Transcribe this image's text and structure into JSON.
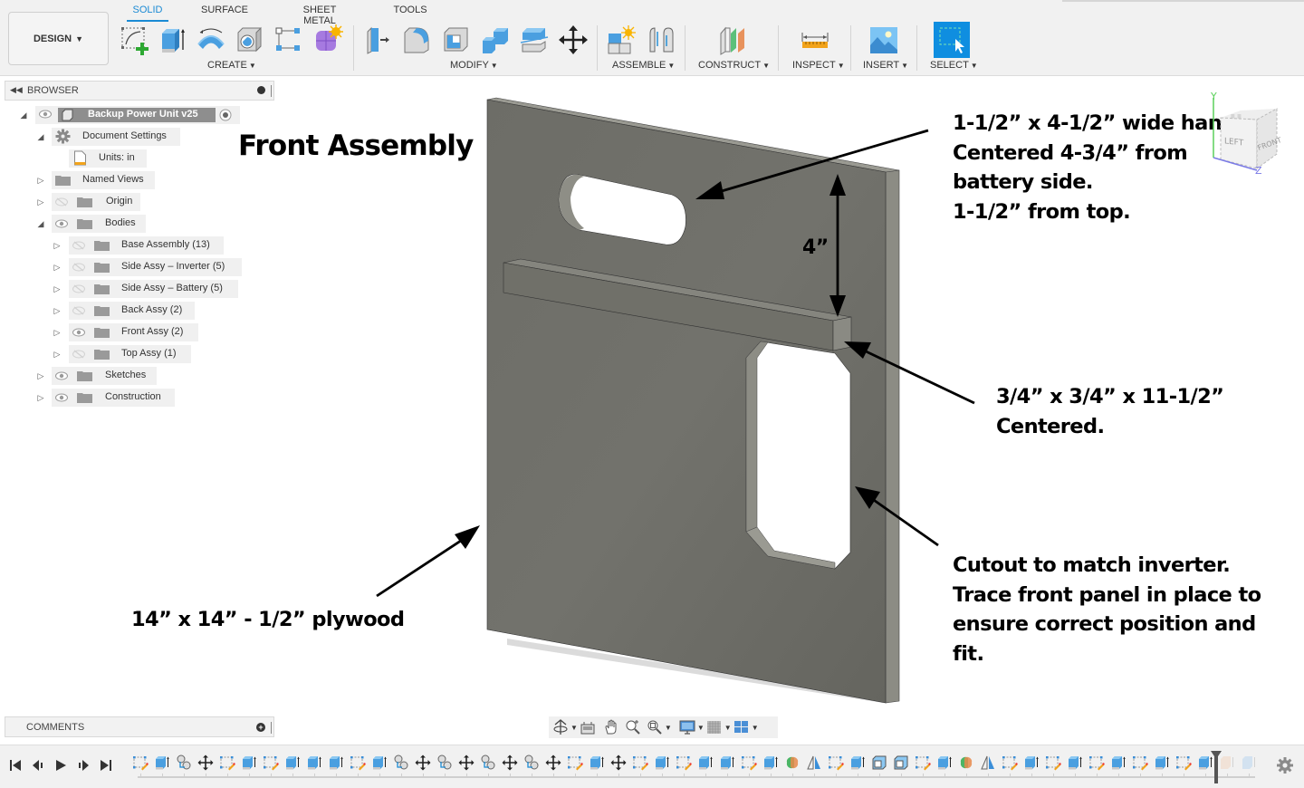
{
  "toolbar": {
    "workspace_button": "DESIGN",
    "tabs": [
      {
        "label": "SOLID",
        "active": true
      },
      {
        "label": "SURFACE",
        "active": false
      },
      {
        "label": "SHEET METAL",
        "active": false
      },
      {
        "label": "TOOLS",
        "active": false
      }
    ],
    "groups": {
      "create": {
        "label": "CREATE",
        "tools": [
          "create-sketch",
          "extrude",
          "revolve",
          "hole",
          "pattern",
          "create-form"
        ]
      },
      "modify": {
        "label": "MODIFY",
        "tools": [
          "press-pull",
          "fillet",
          "shell",
          "combine",
          "split-body",
          "move-copy"
        ]
      },
      "assemble": {
        "label": "ASSEMBLE",
        "tools": [
          "new-component",
          "joint"
        ]
      },
      "construct": {
        "label": "CONSTRUCT",
        "tools": [
          "offset-plane"
        ]
      },
      "inspect": {
        "label": "INSPECT",
        "tools": [
          "measure"
        ]
      },
      "insert": {
        "label": "INSERT",
        "tools": [
          "insert-image"
        ]
      },
      "select": {
        "label": "SELECT",
        "tools": [
          "window-select"
        ]
      }
    },
    "accent_color": "#1a8ad4"
  },
  "browser": {
    "title": "BROWSER",
    "root": {
      "label": "Backup Power Unit v25"
    },
    "items": [
      {
        "label": "Document Settings",
        "expanded": true,
        "icon": "gear"
      },
      {
        "label": "Units: in",
        "icon": "units"
      },
      {
        "label": "Named Views",
        "expanded": false,
        "icon": "folder"
      },
      {
        "label": "Origin",
        "expanded": false,
        "visible": false,
        "icon": "folder"
      },
      {
        "label": "Bodies",
        "expanded": true,
        "visible": true,
        "icon": "folder"
      },
      {
        "label": "Base Assembly (13)",
        "visible": false,
        "icon": "folder"
      },
      {
        "label": "Side Assy – Inverter (5)",
        "visible": false,
        "icon": "folder"
      },
      {
        "label": "Side Assy – Battery (5)",
        "visible": false,
        "icon": "folder"
      },
      {
        "label": "Back Assy (2)",
        "visible": false,
        "icon": "folder"
      },
      {
        "label": "Front Assy (2)",
        "visible": true,
        "icon": "folder"
      },
      {
        "label": "Top Assy (1)",
        "visible": false,
        "icon": "folder"
      },
      {
        "label": "Sketches",
        "expanded": false,
        "visible": true,
        "icon": "folder"
      },
      {
        "label": "Construction",
        "expanded": false,
        "visible": true,
        "icon": "folder"
      }
    ]
  },
  "viewport": {
    "title": "Front Assembly",
    "annotations": {
      "handle": [
        "1-1/2” x 4-1/2” wide handle",
        "Centered 4-3/4” from",
        "battery side.",
        "1-1/2” from top."
      ],
      "dimension": "4”",
      "rail": [
        "3/4” x 3/4” x 11-1/2”",
        "Centered."
      ],
      "cutout": [
        "Cutout to match inverter.",
        "Trace front panel in place to",
        "ensure correct position and",
        "fit."
      ],
      "plywood": "14” x 14” - 1/2” plywood"
    },
    "viewcube": {
      "faces": [
        "LEFT",
        "FRONT"
      ],
      "axes": [
        "Y",
        "Z"
      ]
    }
  },
  "comments": {
    "title": "COMMENTS"
  },
  "navbar": {
    "tools": [
      "orbit",
      "look-at",
      "pan",
      "zoom",
      "fit",
      "display-settings",
      "grid-snap",
      "viewports"
    ]
  },
  "timeline": {
    "controls": [
      "first",
      "previous",
      "play",
      "next",
      "last"
    ],
    "features": [
      "sketch",
      "extrude",
      "joint",
      "move",
      "sketch",
      "extrude",
      "sketch",
      "extrude",
      "extrude",
      "extrude",
      "sketch",
      "extrude",
      "joint",
      "move",
      "joint",
      "move",
      "joint",
      "move",
      "joint",
      "move",
      "sketch",
      "extrude",
      "move",
      "sketch",
      "extrude",
      "sketch",
      "extrude",
      "extrude",
      "sketch",
      "extrude",
      "combine",
      "mirror",
      "sketch",
      "extrude",
      "shell",
      "shell",
      "sketch",
      "extrude",
      "combine",
      "mirror",
      "sketch",
      "extrude",
      "sketch",
      "extrude",
      "sketch",
      "extrude",
      "sketch",
      "extrude",
      "sketch",
      "extrude",
      "sketch-suppressed",
      "extrude-suppressed"
    ]
  }
}
